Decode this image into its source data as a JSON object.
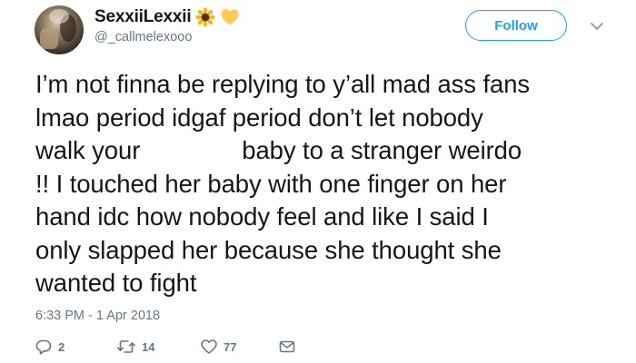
{
  "user": {
    "display_name": "SexxiiLexxii",
    "handle": "@_callmelexooo",
    "name_emojis": [
      "sunflower-emoji",
      "yellow-heart-emoji"
    ]
  },
  "follow_button": {
    "label": "Follow"
  },
  "tweet": {
    "lines": [
      "I’m not finna be replying to y’all mad ass fans",
      "lmao period idgaf period don’t let nobody",
      "walk your",
      "baby to a stranger weirdo",
      "!! I touched her baby with one finger on her",
      "hand idc how nobody feel and like I said I",
      "only slapped her because she thought she",
      "wanted to fight"
    ],
    "timestamp": "6:33 PM - 1 Apr 2018"
  },
  "actions": {
    "replies": "2",
    "retweets": "14",
    "likes": "77"
  },
  "colors": {
    "accent": "#1da1f2",
    "text": "#14171a",
    "muted": "#657786"
  }
}
